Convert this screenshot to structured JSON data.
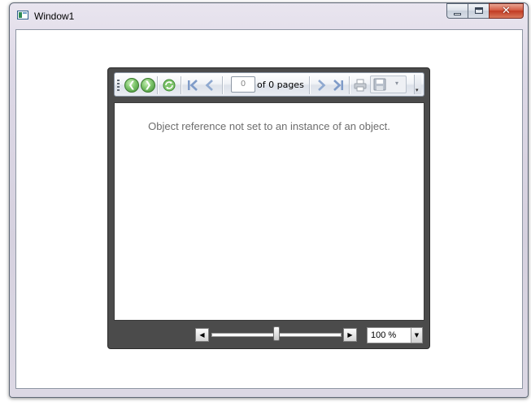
{
  "window": {
    "title": "Window1",
    "close_glyph": "✕"
  },
  "toolbar": {
    "back_glyph": "❮",
    "forward_glyph": "❯",
    "page_number": "0",
    "page_of_text": "of 0 pages",
    "overflow_glyph": "▾",
    "save_arrow": "▾"
  },
  "document": {
    "error_message": "Object reference not set to an instance of an object."
  },
  "zoom": {
    "value": "100 %",
    "left_glyph": "◀",
    "right_glyph": "▶",
    "drop_glyph": "▼",
    "slider_level": 0.5
  },
  "icons": {
    "nav_back": "back-arrow-icon",
    "nav_forward": "forward-arrow-icon",
    "refresh": "refresh-icon",
    "first_page": "first-page-icon",
    "prev_page": "previous-page-icon",
    "next_page": "next-page-icon",
    "last_page": "last-page-icon",
    "print": "print-icon",
    "save": "save-icon"
  },
  "colors": {
    "viewer_frame": "#4b4b4b",
    "nav_green": "#5aa948",
    "page_nav_blue": "#8fa9d0",
    "error_text": "#6d6d6d"
  }
}
